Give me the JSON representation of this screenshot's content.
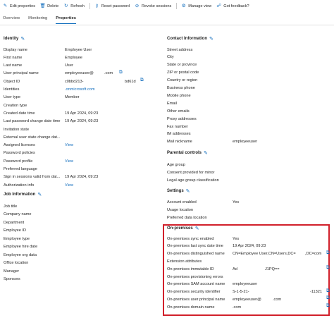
{
  "toolbar": {
    "edit": "Edit properties",
    "delete": "Delete",
    "refresh": "Refresh",
    "reset_password": "Reset password",
    "revoke": "Revoke sessions",
    "manage_view": "Manage view",
    "feedback": "Got feedback?"
  },
  "tabs": [
    "Overview",
    "Monitoring",
    "Properties"
  ],
  "identity": {
    "title": "Identity",
    "rows": [
      {
        "label": "Display name",
        "value": "Employee User"
      },
      {
        "label": "First name",
        "value": "Employee"
      },
      {
        "label": "Last name",
        "value": "User"
      },
      {
        "label": "User principal name",
        "value": "employeeuser@",
        "value2": ".com"
      },
      {
        "label": "Object ID",
        "value": "c0bbd213-",
        "value2": "bd61d"
      },
      {
        "label": "Identities",
        "value": ".onmicrosoft.com"
      },
      {
        "label": "User type",
        "value": "Member"
      },
      {
        "label": "Creation type",
        "value": ""
      },
      {
        "label": "Created date time",
        "value": "19 Apr 2024, 09:23"
      },
      {
        "label": "Last password change date time",
        "value": "19 Apr 2024, 09:23"
      },
      {
        "label": "Invitation state",
        "value": ""
      },
      {
        "label": "External user state change dat...",
        "value": ""
      },
      {
        "label": "Assigned licenses",
        "value": "View"
      },
      {
        "label": "Password policies",
        "value": ""
      },
      {
        "label": "Password profile",
        "value": "View"
      },
      {
        "label": "Preferred language",
        "value": ""
      },
      {
        "label": "Sign in sessions valid from dat...",
        "value": "19 Apr 2024, 09:23"
      },
      {
        "label": "Authorization info",
        "value": "View"
      }
    ]
  },
  "job": {
    "title": "Job Information",
    "rows": [
      "Job title",
      "Company name",
      "Department",
      "Employee ID",
      "Employee type",
      "Employee hire date",
      "Employee org data",
      "Office location",
      "Manager",
      "Sponsors"
    ]
  },
  "contact": {
    "title": "Contact Information",
    "rows": [
      {
        "label": "Street address",
        "value": ""
      },
      {
        "label": "City",
        "value": ""
      },
      {
        "label": "State or province",
        "value": ""
      },
      {
        "label": "ZIP or postal code",
        "value": ""
      },
      {
        "label": "Country or region",
        "value": ""
      },
      {
        "label": "Business phone",
        "value": ""
      },
      {
        "label": "Mobile phone",
        "value": ""
      },
      {
        "label": "Email",
        "value": ""
      },
      {
        "label": "Other emails",
        "value": ""
      },
      {
        "label": "Proxy addresses",
        "value": ""
      },
      {
        "label": "Fax number",
        "value": ""
      },
      {
        "label": "IM addresses",
        "value": ""
      },
      {
        "label": "Mail nickname",
        "value": "employeeuser"
      }
    ]
  },
  "parental": {
    "title": "Parental controls",
    "rows": [
      "Age group",
      "Consent provided for minor",
      "Legal age group classification"
    ]
  },
  "settings": {
    "title": "Settings",
    "rows": [
      {
        "label": "Account enabled",
        "value": "Yes"
      },
      {
        "label": "Usage location",
        "value": ""
      },
      {
        "label": "Preferred data location",
        "value": ""
      }
    ]
  },
  "onprem": {
    "title": "On-premises",
    "rows": [
      {
        "label": "On-premises sync enabled",
        "value": "Yes"
      },
      {
        "label": "On-premises last sync date time",
        "value": "19 Apr 2024, 09:23"
      },
      {
        "label": "On-premises distinguished name",
        "value": "CN=Employee User,CN=Users,DC=",
        "value2": ",DC=com"
      },
      {
        "label": "Extension attributes",
        "value": ""
      },
      {
        "label": "On-premises immutable ID",
        "value": "Ad",
        "value2": "J1PQ=="
      },
      {
        "label": "On-premises provisioning errors",
        "value": ""
      },
      {
        "label": "On-premises SAM account name",
        "value": "employeeuser"
      },
      {
        "label": "On-premises security identifier",
        "value": "S-1-5-21-",
        "value2": "-11321"
      },
      {
        "label": "On-premises user principal name",
        "value": "employeeuser@",
        "value2": ".com"
      },
      {
        "label": "On-premises domain name",
        "value": ".com"
      }
    ]
  },
  "colors": {
    "accent": "#0f6cbd",
    "highlight_border": "#d1202b"
  }
}
